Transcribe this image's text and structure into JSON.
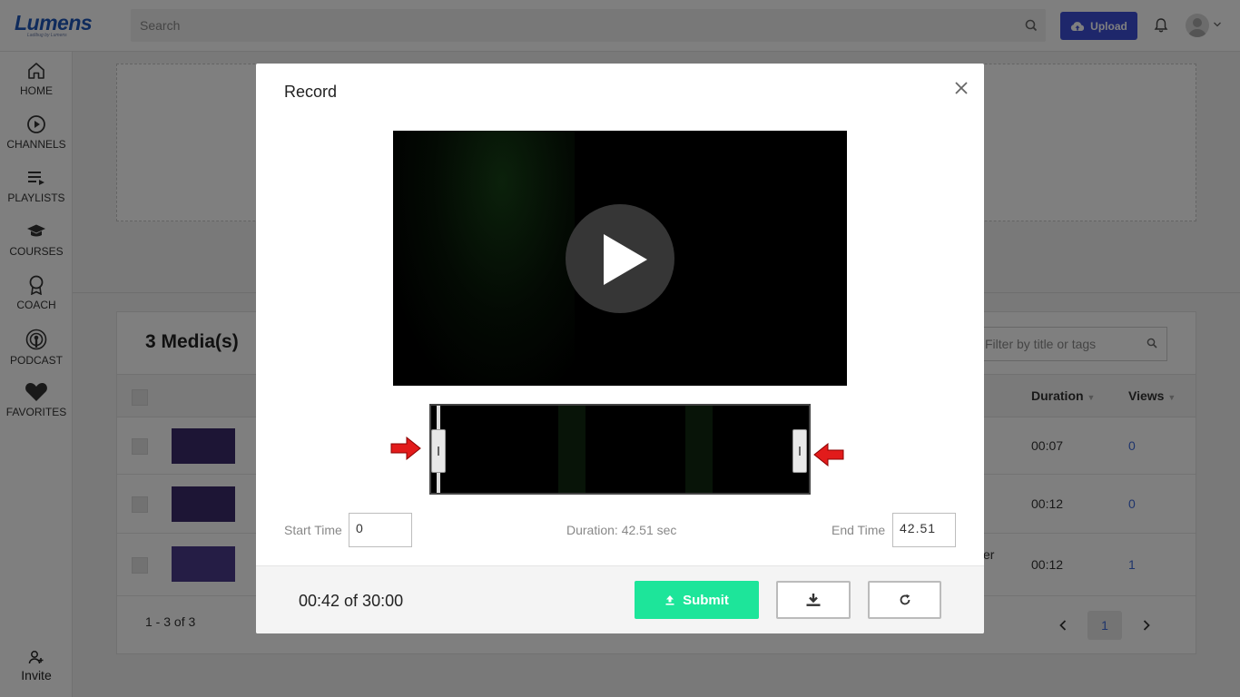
{
  "app": {
    "logo": "Lumens",
    "logo_tagline": "Ladibug by Lumens"
  },
  "header": {
    "search_placeholder": "Search",
    "upload_label": "Upload",
    "icons": [
      "search-icon",
      "cloud-upload-icon",
      "bell-icon",
      "avatar",
      "chevron-down-icon"
    ]
  },
  "sidebar": {
    "items": [
      {
        "label": "HOME",
        "icon": "home-icon"
      },
      {
        "label": "CHANNELS",
        "icon": "play-circle-icon"
      },
      {
        "label": "PLAYLISTS",
        "icon": "playlist-icon"
      },
      {
        "label": "COURSES",
        "icon": "graduation-cap-icon"
      },
      {
        "label": "COACH",
        "icon": "award-icon"
      },
      {
        "label": "PODCAST",
        "icon": "podcast-icon"
      },
      {
        "label": "FAVORITES",
        "icon": "heart-icon"
      }
    ],
    "invite_label": "Invite"
  },
  "media": {
    "count_title": "3 Media(s)",
    "filter_placeholder": "Filter by title or tags",
    "columns": {
      "duration": "Duration",
      "views": "Views"
    },
    "rows": [
      {
        "duration": "00:07",
        "views": "0",
        "trailing_text": ""
      },
      {
        "duration": "00:12",
        "views": "0",
        "trailing_text": ""
      },
      {
        "duration": "00:12",
        "views": "1",
        "trailing_text": "er"
      }
    ],
    "pager_info": "1 - 3 of 3",
    "current_page": "1"
  },
  "modal": {
    "title": "Record",
    "start_label": "Start Time",
    "start_value": "0",
    "duration_text": "Duration: 42.51 sec",
    "end_label": "End Time",
    "end_value": "42.51",
    "elapsed": "00:42 of 30:00",
    "submit_label": "Submit",
    "colors": {
      "submit": "#1de59a",
      "arrow": "#e21b1b"
    }
  }
}
